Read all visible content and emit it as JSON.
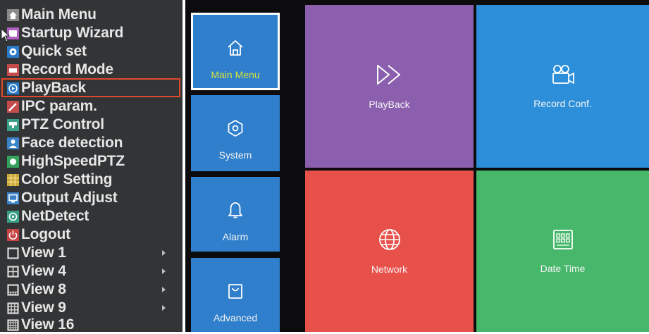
{
  "menu": {
    "items": [
      {
        "label": "Main Menu",
        "icon": "home-icon",
        "color": "#9a9a9a"
      },
      {
        "label": "Startup Wizard",
        "icon": "wizard-icon",
        "color": "#b25fc4"
      },
      {
        "label": "Quick set",
        "icon": "quick-set-icon",
        "color": "#2b7bc8"
      },
      {
        "label": "Record Mode",
        "icon": "record-icon",
        "color": "#c44b4b"
      },
      {
        "label": "PlayBack",
        "icon": "playback-icon",
        "color": "#2b7bc8"
      },
      {
        "label": "IPC param.",
        "icon": "ipc-icon",
        "color": "#c44b4b"
      },
      {
        "label": "PTZ Control",
        "icon": "ptz-icon",
        "color": "#3aa089"
      },
      {
        "label": "Face detection",
        "icon": "face-detection-icon",
        "color": "#3b84c9"
      },
      {
        "label": "HighSpeedPTZ",
        "icon": "highspeed-ptz-icon",
        "color": "#35a35d"
      },
      {
        "label": "Color Setting",
        "icon": "color-setting-icon",
        "color": "#c9a838"
      },
      {
        "label": "Output Adjust",
        "icon": "output-adjust-icon",
        "color": "#3b84c9"
      },
      {
        "label": "NetDetect",
        "icon": "netdetect-icon",
        "color": "#3aa089"
      },
      {
        "label": "Logout",
        "icon": "logout-icon",
        "color": "#c64444"
      },
      {
        "label": "View 1",
        "icon": "view-1-icon",
        "color": "#d8d8d8"
      },
      {
        "label": "View 4",
        "icon": "view-4-icon",
        "color": "#d8d8d8"
      },
      {
        "label": "View 8",
        "icon": "view-8-icon",
        "color": "#d8d8d8"
      },
      {
        "label": "View 9",
        "icon": "view-9-icon",
        "color": "#d8d8d8"
      },
      {
        "label": "View 16",
        "icon": "view-16-icon",
        "color": "#d8d8d8"
      }
    ],
    "highlighted": "PlayBack"
  },
  "nav": {
    "items": [
      {
        "label": "Main Menu",
        "icon": "home-icon",
        "selected": true
      },
      {
        "label": "System",
        "icon": "gear-icon",
        "selected": false
      },
      {
        "label": "Alarm",
        "icon": "bell-icon",
        "selected": false
      },
      {
        "label": "Advanced",
        "icon": "bag-icon",
        "selected": false
      }
    ],
    "selected_label_color": "#d9e33a"
  },
  "tiles": [
    {
      "label": "PlayBack",
      "icon": "fast-forward-icon",
      "color": "#8b5fae"
    },
    {
      "label": "Record Conf.",
      "icon": "video-camera-icon",
      "color": "#2d8fd9"
    },
    {
      "label": "Network",
      "icon": "globe-icon",
      "color": "#e8504a"
    },
    {
      "label": "Date Time",
      "icon": "calendar-icon",
      "color": "#47b86b"
    }
  ],
  "colors": {
    "menu_bg": "#323436",
    "menu_text": "#e6e6e6",
    "highlight_border": "#e2482a",
    "nav_tile": "#2f7fcc",
    "panel_bg": "#0c0c0e"
  }
}
